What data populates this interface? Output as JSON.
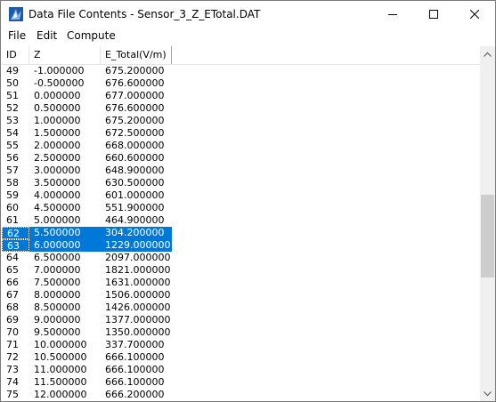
{
  "window": {
    "title": "Data File Contents - Sensor_3_Z_ETotal.DAT",
    "icon": "app-icon"
  },
  "menu": {
    "items": [
      "File",
      "Edit",
      "Compute"
    ]
  },
  "table": {
    "columns": [
      "ID",
      "Z",
      "E_Total(V/m)"
    ],
    "rows": [
      [
        "49",
        "-1.000000",
        "675.200000"
      ],
      [
        "50",
        "-0.500000",
        "676.600000"
      ],
      [
        "51",
        "0.000000",
        "677.000000"
      ],
      [
        "52",
        "0.500000",
        "676.600000"
      ],
      [
        "53",
        "1.000000",
        "675.200000"
      ],
      [
        "54",
        "1.500000",
        "672.500000"
      ],
      [
        "55",
        "2.000000",
        "668.000000"
      ],
      [
        "56",
        "2.500000",
        "660.600000"
      ],
      [
        "57",
        "3.000000",
        "648.900000"
      ],
      [
        "58",
        "3.500000",
        "630.500000"
      ],
      [
        "59",
        "4.000000",
        "601.000000"
      ],
      [
        "60",
        "4.500000",
        "551.900000"
      ],
      [
        "61",
        "5.000000",
        "464.900000"
      ],
      [
        "62",
        "5.500000",
        "304.200000"
      ],
      [
        "63",
        "6.000000",
        "1229.000000"
      ],
      [
        "64",
        "6.500000",
        "2097.000000"
      ],
      [
        "65",
        "7.000000",
        "1821.000000"
      ],
      [
        "66",
        "7.500000",
        "1631.000000"
      ],
      [
        "67",
        "8.000000",
        "1506.000000"
      ],
      [
        "68",
        "8.500000",
        "1426.000000"
      ],
      [
        "69",
        "9.000000",
        "1377.000000"
      ],
      [
        "70",
        "9.500000",
        "1350.000000"
      ],
      [
        "71",
        "10.000000",
        "337.700000"
      ],
      [
        "72",
        "10.500000",
        "666.100000"
      ],
      [
        "73",
        "11.000000",
        "666.100000"
      ],
      [
        "74",
        "11.500000",
        "666.100000"
      ],
      [
        "75",
        "12.000000",
        "666.200000"
      ]
    ],
    "selected_ids": [
      "62",
      "63"
    ]
  },
  "scrollbar": {
    "position_fraction": 0.55
  },
  "colors": {
    "selection": "#0078d7",
    "icon_blue": "#1e5aa8"
  }
}
